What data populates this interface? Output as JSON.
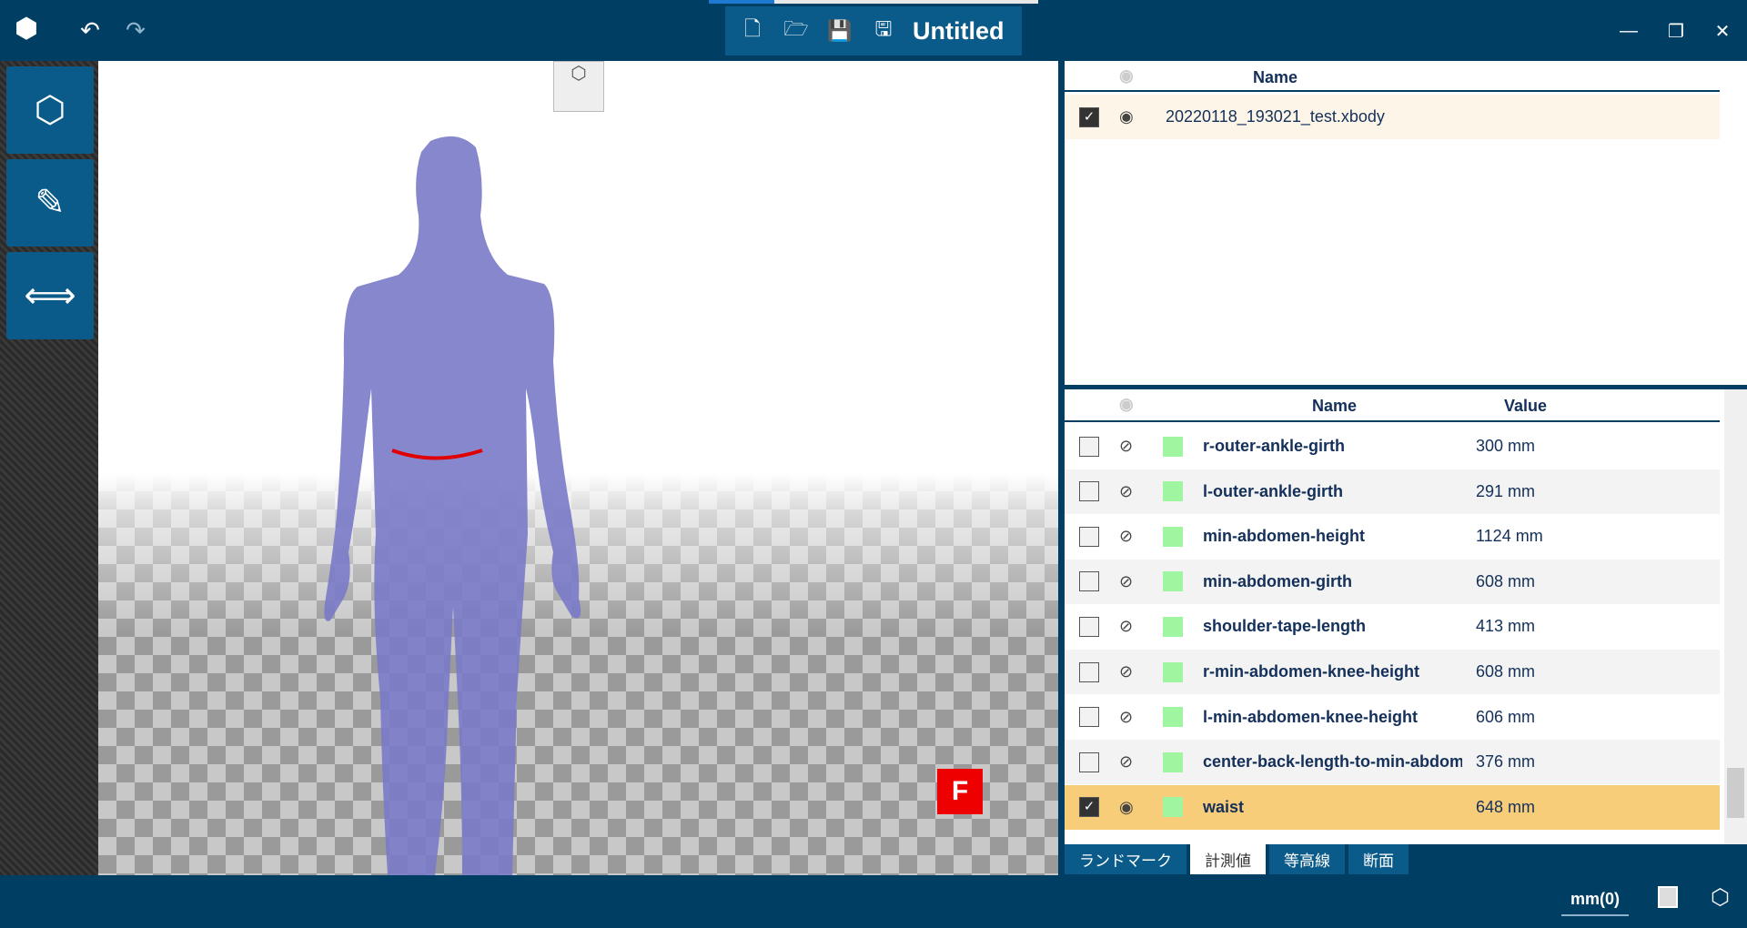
{
  "app": {
    "title": "Untitled"
  },
  "toolbar": {
    "icons": [
      "logo-icon",
      "undo-icon",
      "redo-icon",
      "new-file-icon",
      "open-file-icon",
      "save-icon",
      "save-as-icon"
    ]
  },
  "window": {
    "minimize": "—",
    "maximize": "❐",
    "close": "✕"
  },
  "left_tools": [
    "shape-tool-icon",
    "measure-tool-icon",
    "distance-tool-icon"
  ],
  "viewport": {
    "orientation_label": "F",
    "colors": {
      "body": "#7a7ac8",
      "waist_line": "#e00000"
    }
  },
  "files": {
    "header_name": "Name",
    "rows": [
      {
        "checked": true,
        "visible": true,
        "name": "20220118_193021_test.xbody"
      }
    ]
  },
  "measurements": {
    "header_name": "Name",
    "header_value": "Value",
    "rows": [
      {
        "checked": false,
        "visible": false,
        "name": "r-outer-ankle-girth",
        "value": "300 mm"
      },
      {
        "checked": false,
        "visible": false,
        "name": "l-outer-ankle-girth",
        "value": "291 mm"
      },
      {
        "checked": false,
        "visible": false,
        "name": "min-abdomen-height",
        "value": "1124 mm"
      },
      {
        "checked": false,
        "visible": false,
        "name": "min-abdomen-girth",
        "value": "608 mm"
      },
      {
        "checked": false,
        "visible": false,
        "name": "shoulder-tape-length",
        "value": "413 mm"
      },
      {
        "checked": false,
        "visible": false,
        "name": "r-min-abdomen-knee-height",
        "value": "608 mm"
      },
      {
        "checked": false,
        "visible": false,
        "name": "l-min-abdomen-knee-height",
        "value": "606 mm"
      },
      {
        "checked": false,
        "visible": false,
        "name": "center-back-length-to-min-abdom",
        "value": "376 mm"
      },
      {
        "checked": true,
        "visible": true,
        "name": "waist",
        "value": "648 mm",
        "selected": true
      }
    ]
  },
  "tabs": [
    {
      "label": "ランドマーク"
    },
    {
      "label": "計測値",
      "active": true
    },
    {
      "label": "等高線"
    },
    {
      "label": "断面"
    }
  ],
  "status": {
    "unit": "mm(0)"
  }
}
